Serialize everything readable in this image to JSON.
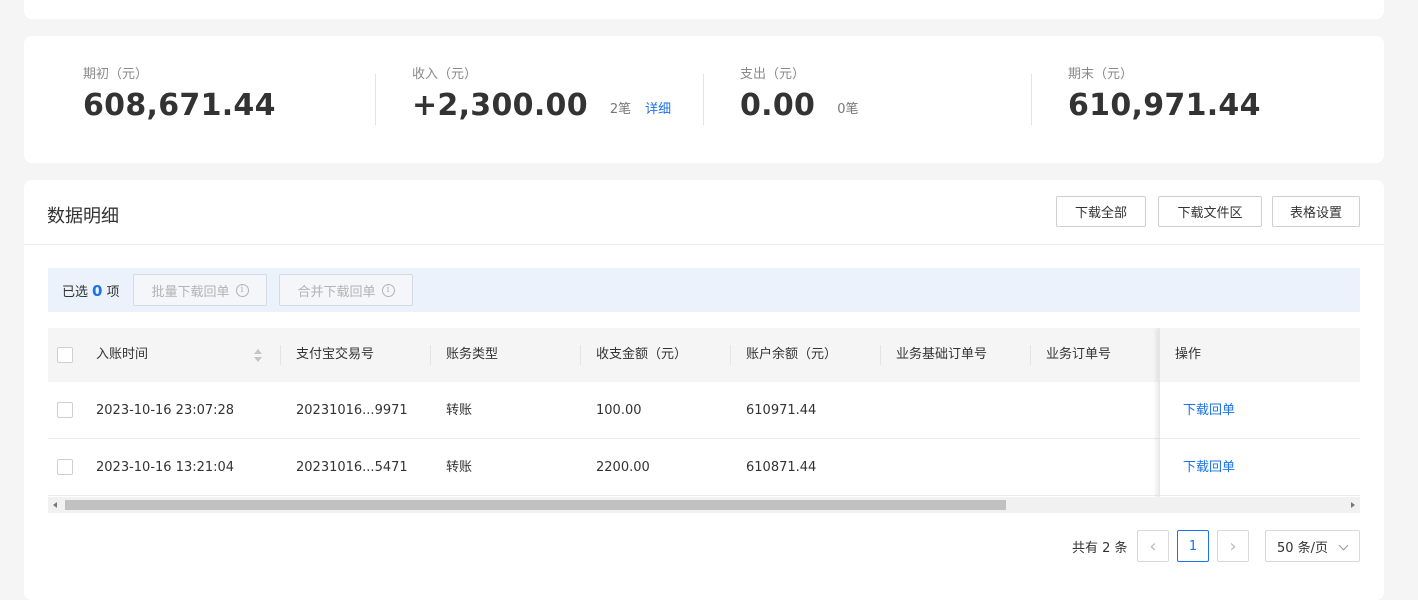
{
  "summary": {
    "opening": {
      "label": "期初（元）",
      "value": "608,671.44"
    },
    "income": {
      "label": "收入（元）",
      "value": "+2,300.00",
      "count": "2笔",
      "detail_link": "详细"
    },
    "expense": {
      "label": "支出（元）",
      "value": "0.00",
      "count": "0笔"
    },
    "closing": {
      "label": "期末（元）",
      "value": "610,971.44"
    }
  },
  "detail": {
    "title": "数据明细",
    "buttons": {
      "download_all": "下载全部",
      "download_files": "下载文件区",
      "table_settings": "表格设置"
    }
  },
  "selection": {
    "prefix": "已选",
    "count": "0",
    "suffix": "项",
    "batch_download": "批量下载回单",
    "merge_download": "合并下载回单",
    "info_glyph": "i"
  },
  "table": {
    "columns": [
      "入账时间",
      "支付宝交易号",
      "账务类型",
      "收支金额（元）",
      "账户余额（元）",
      "业务基础订单号",
      "业务订单号",
      "操作"
    ],
    "rows": [
      {
        "time": "2023-10-16 23:07:28",
        "trade_no": "20231016...9971",
        "type": "转账",
        "amount": "100.00",
        "balance": "610971.44",
        "base_order": "",
        "order": "",
        "action": "下载回单"
      },
      {
        "time": "2023-10-16 13:21:04",
        "trade_no": "20231016...5471",
        "type": "转账",
        "amount": "2200.00",
        "balance": "610871.44",
        "base_order": "",
        "order": "",
        "action": "下载回单"
      }
    ]
  },
  "pagination": {
    "total": "共有 2 条",
    "prev_glyph": "‹",
    "next_glyph": "›",
    "current_page": "1",
    "page_size": "50 条/页"
  },
  "colors": {
    "accent": "#1a73e8",
    "background": "#f5f5f5",
    "selection_bar": "#ebf2fc"
  }
}
